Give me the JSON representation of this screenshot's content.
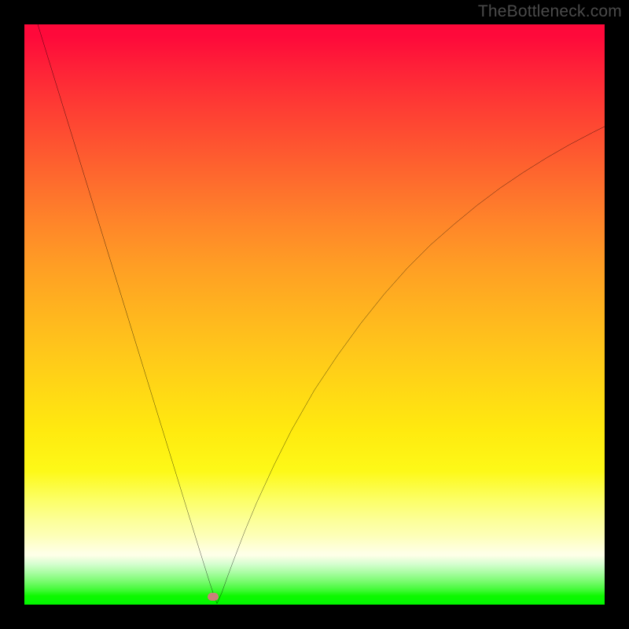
{
  "watermark": "TheBottleneck.com",
  "colors": {
    "frame_border": "#000000",
    "curve_stroke": "#000000",
    "marker_fill": "#cc7f7a"
  },
  "chart_data": {
    "type": "line",
    "title": "",
    "xlabel": "",
    "ylabel": "",
    "xlim": [
      0,
      100
    ],
    "ylim": [
      0,
      100
    ],
    "grid": false,
    "legend": false,
    "annotations": [
      {
        "type": "marker",
        "x": 32.5,
        "y": 1.3,
        "shape": "pill"
      }
    ],
    "series": [
      {
        "name": "curve",
        "x": [
          0,
          2,
          4,
          6,
          8,
          10,
          12,
          14,
          16,
          18,
          20,
          22,
          24,
          26,
          28,
          30,
          31,
          32,
          32.6,
          33.2,
          34,
          35,
          36,
          38,
          40,
          43,
          46,
          50,
          54,
          58,
          62,
          66,
          70,
          74,
          78,
          82,
          86,
          90,
          94,
          98,
          100
        ],
        "y": [
          108,
          101,
          94.5,
          88,
          81.5,
          75,
          68.5,
          62,
          55.5,
          49,
          42.5,
          36,
          29.5,
          23,
          16.5,
          10,
          6.8,
          3.6,
          1.8,
          0.2,
          2,
          4.8,
          7.5,
          12.7,
          17.5,
          24,
          30,
          37,
          43,
          48.5,
          53.5,
          58,
          62,
          65.5,
          68.8,
          71.8,
          74.5,
          77,
          79.3,
          81.4,
          82.4
        ]
      }
    ]
  }
}
